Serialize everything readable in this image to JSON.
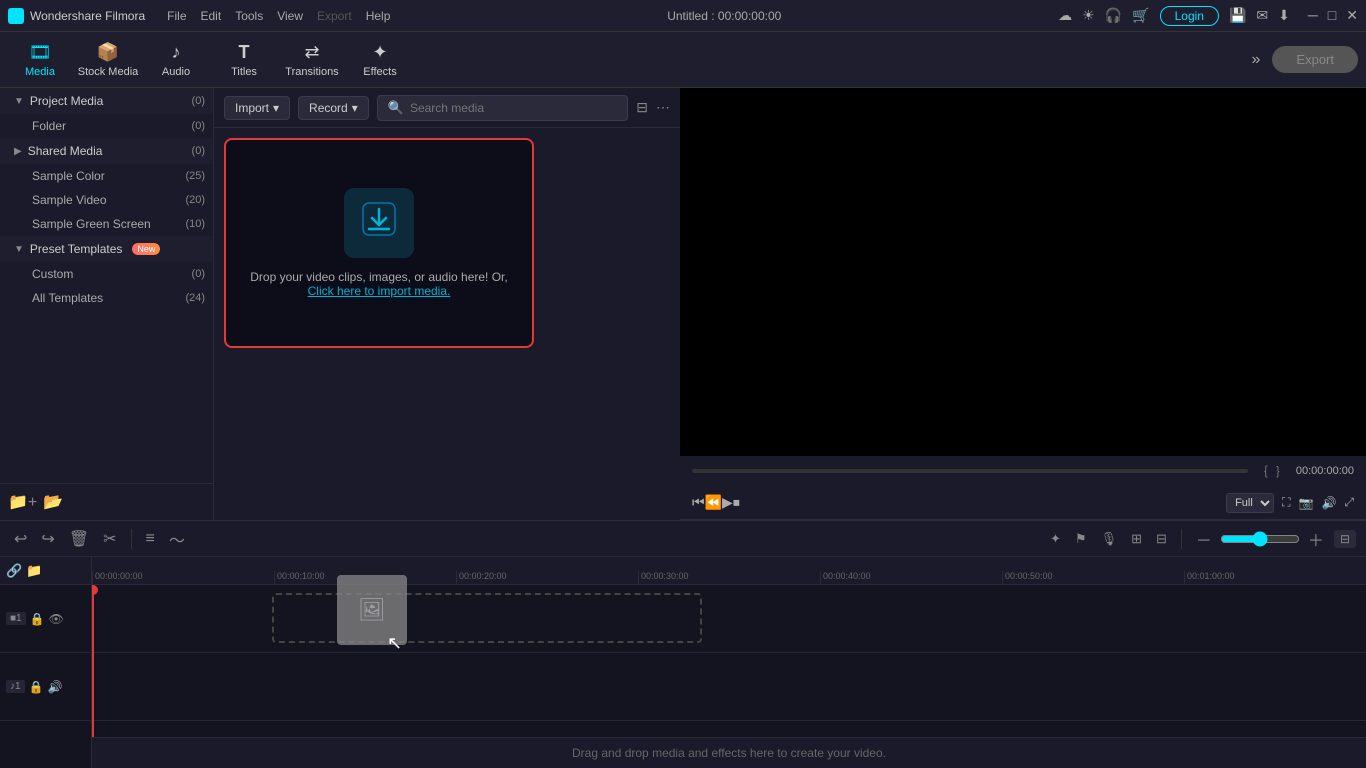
{
  "app": {
    "name": "Wondershare Filmora",
    "title": "Untitled : 00:00:00:00"
  },
  "menu": {
    "items": [
      "File",
      "Edit",
      "Tools",
      "View",
      "Export",
      "Help"
    ]
  },
  "toolbar": {
    "items": [
      {
        "id": "media",
        "label": "Media",
        "icon": "🎞",
        "active": true
      },
      {
        "id": "stock-media",
        "label": "Stock Media",
        "icon": "📦",
        "active": false
      },
      {
        "id": "audio",
        "label": "Audio",
        "icon": "♪",
        "active": false
      },
      {
        "id": "titles",
        "label": "Titles",
        "icon": "T",
        "active": false
      },
      {
        "id": "transitions",
        "label": "Transitions",
        "icon": "⟷",
        "active": false
      },
      {
        "id": "effects",
        "label": "Effects",
        "icon": "✦",
        "active": false
      }
    ],
    "export_label": "Export"
  },
  "sidebar": {
    "project_media": {
      "label": "Project Media",
      "count": "(0)",
      "items": [
        {
          "label": "Folder",
          "count": "(0)"
        }
      ]
    },
    "shared_media": {
      "label": "Shared Media",
      "count": "(0)"
    },
    "sample_items": [
      {
        "label": "Sample Color",
        "count": "(25)"
      },
      {
        "label": "Sample Video",
        "count": "(20)"
      },
      {
        "label": "Sample Green Screen",
        "count": "(10)"
      }
    ],
    "preset_templates": {
      "label": "Preset Templates",
      "badge": "New",
      "items": [
        {
          "label": "Custom",
          "count": "(0)"
        },
        {
          "label": "All Templates",
          "count": "(24)"
        }
      ]
    }
  },
  "content": {
    "import_label": "Import",
    "record_label": "Record",
    "search_placeholder": "Search media",
    "drop_text": "Drop your video clips, images, or audio here! Or,",
    "drop_link": "Click here to import media."
  },
  "preview": {
    "time": "00:00:00:00",
    "quality": "Full",
    "markers": [
      "{",
      "}"
    ]
  },
  "timeline": {
    "tracks": [
      {
        "num": "1",
        "type": "video"
      },
      {
        "num": "1",
        "type": "audio"
      }
    ],
    "time_marks": [
      "00:00:00:00",
      "00:00:10:00",
      "00:00:20:00",
      "00:00:30:00",
      "00:00:40:00",
      "00:00:50:00",
      "00:01:00:00"
    ],
    "drop_message": "Drag and drop media and effects here to create your video."
  },
  "edit_toolbar": {
    "undo": "↩",
    "redo": "↪",
    "delete": "🗑",
    "cut": "✂",
    "audio_eq": "≡",
    "waveform": "〜"
  }
}
